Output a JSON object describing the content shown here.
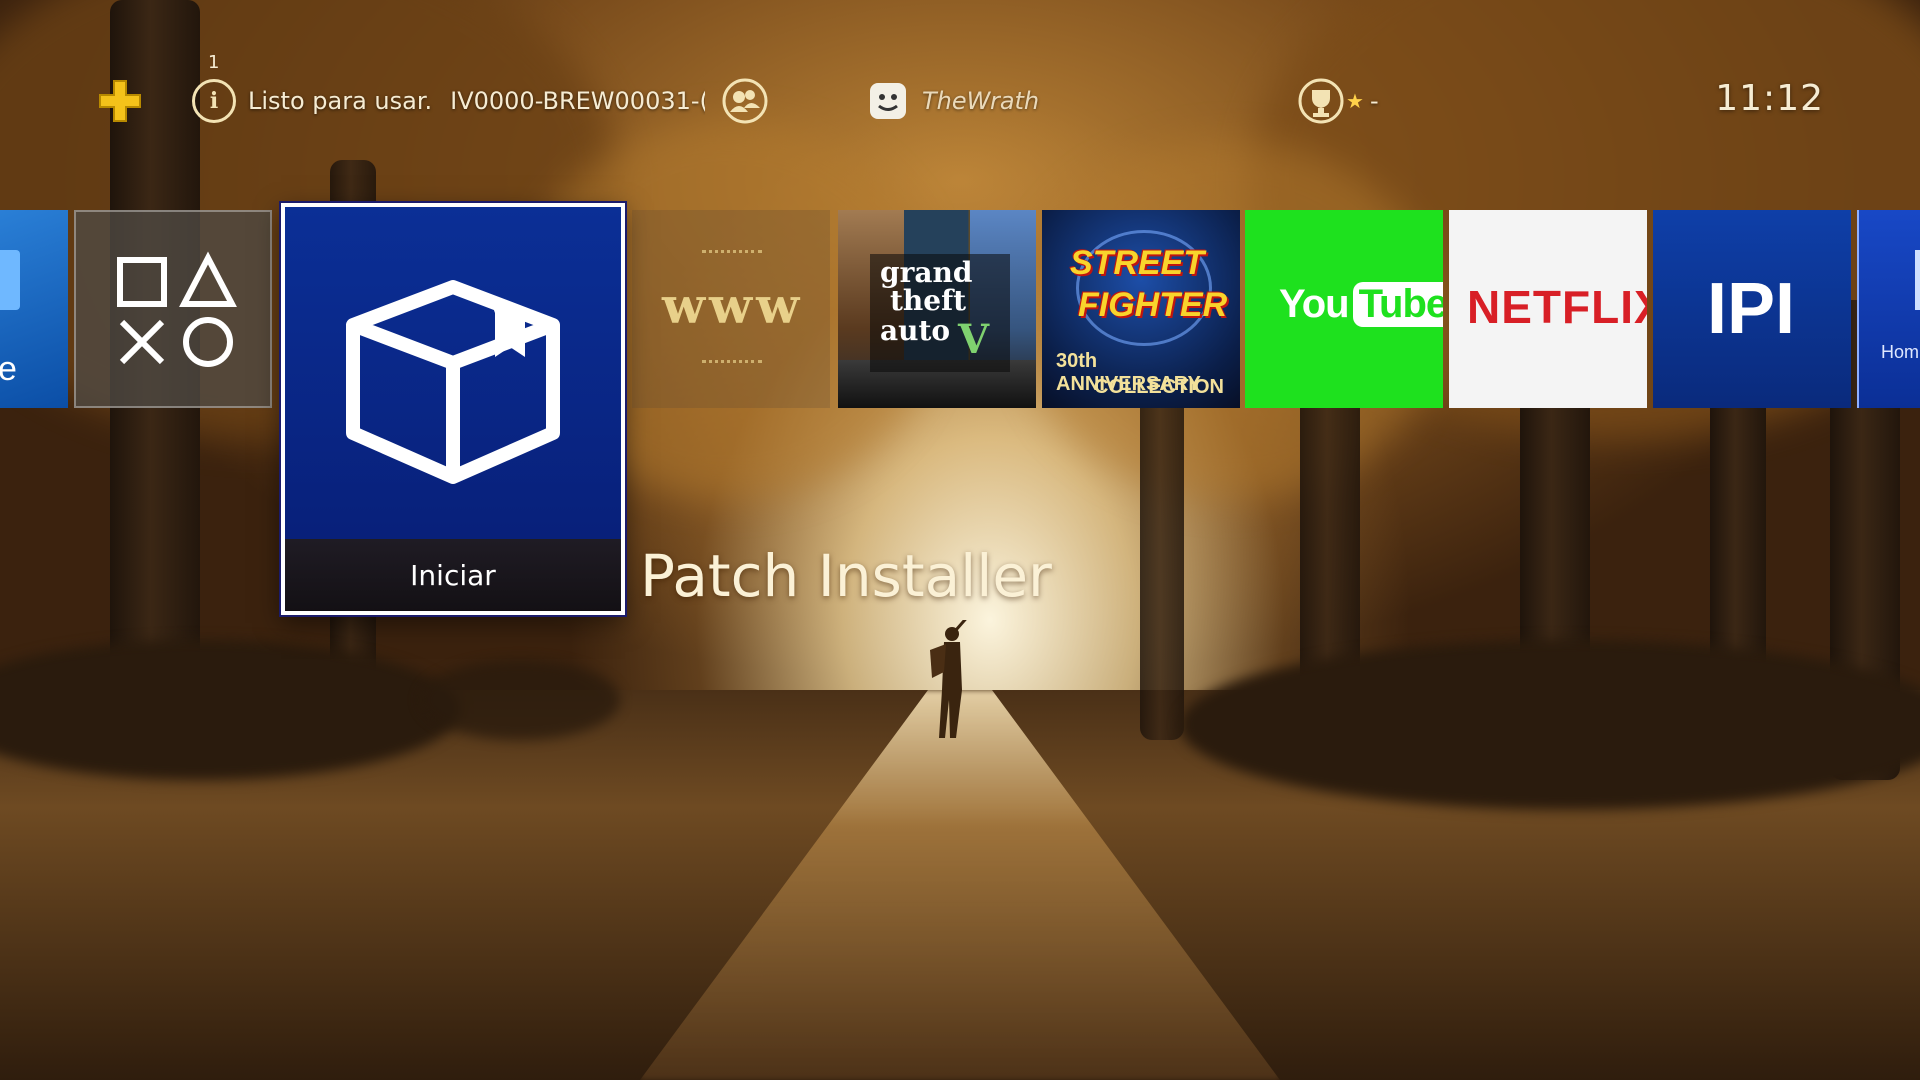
{
  "topbar": {
    "notification_count": "1",
    "notification_text": "Listo para usar.",
    "notification_id": "IV0000-BREW00031-(",
    "username": "TheWrath",
    "trophy_suffix": "-",
    "clock": "11:12"
  },
  "tiles": {
    "store_label": "e",
    "patch_installer": {
      "action": "Iniciar",
      "title": "Patch Installer"
    },
    "www_label": "www",
    "gta_label_1": "grand",
    "gta_label_2": "theft",
    "gta_label_3": "auto",
    "gta_label_4": "V",
    "sf_label_1": "STREET",
    "sf_label_2": "FIGHTER",
    "sf_label_3": "30th ANNIVERSARY",
    "sf_label_4": "COLLECTION",
    "youtube_label_1": "You",
    "youtube_label_2": "Tube",
    "netflix_label": "NETFLIX",
    "ipi_label": "IPI",
    "home_label": "Hom"
  },
  "colors": {
    "selection_border": "#ffffff",
    "youtube_bg": "#1ee11e",
    "netflix_red": "#d81f26",
    "ps_blue": "#0b2f96"
  },
  "icons": [
    "ps-plus-icon",
    "info-icon",
    "friends-icon",
    "profile-icon",
    "trophy-icon",
    "package-icon",
    "ps-shapes-icon"
  ]
}
